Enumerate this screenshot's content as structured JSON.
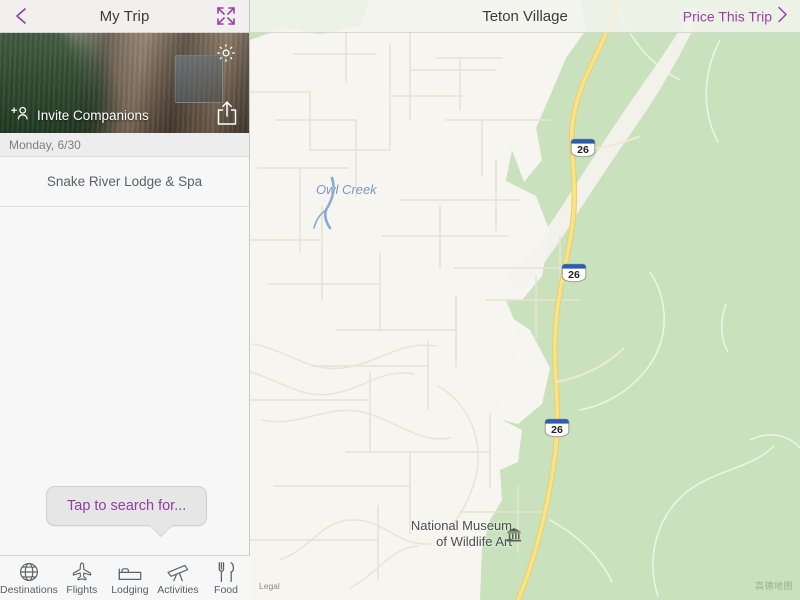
{
  "sidebar": {
    "header": {
      "title": "My Trip",
      "back_icon": "chevron-left-icon",
      "expand_icon": "expand-arrows-icon"
    },
    "hero": {
      "gear_icon": "gear-icon",
      "share_icon": "share-icon",
      "invite_icon": "add-person-icon",
      "invite_label": "Invite Companions"
    },
    "itinerary": {
      "day_label": "Monday, 6/30",
      "items": [
        {
          "title": "Snake River Lodge & Spa"
        }
      ]
    },
    "tooltip": {
      "text": "Tap to search for..."
    },
    "tabs": [
      {
        "label": "Destinations",
        "icon": "globe-icon"
      },
      {
        "label": "Flights",
        "icon": "airplane-icon"
      },
      {
        "label": "Lodging",
        "icon": "bed-icon"
      },
      {
        "label": "Activities",
        "icon": "telescope-icon"
      },
      {
        "label": "Food",
        "icon": "fork-knife-icon"
      }
    ]
  },
  "map": {
    "header": {
      "title": "Teton Village",
      "price_label": "Price This Trip",
      "price_chevron_icon": "chevron-right-icon"
    },
    "labels": {
      "creek": "Owl Creek",
      "museum_line1": "National Museum",
      "museum_line2": "of Wildlife Art",
      "museum_icon": "museum-icon"
    },
    "shields": [
      {
        "route": "26"
      },
      {
        "route": "26"
      },
      {
        "route": "26"
      }
    ],
    "legal": "Legal",
    "attribution": "高德地图"
  },
  "colors": {
    "accent_purple": "#9c3faa",
    "panel_bg": "#f7f7f7",
    "map_land": "#f7f5ef",
    "map_forest": "#c9e2bd",
    "highway_yellow": "#f0d978",
    "shield_blue": "#2a5fb0",
    "creek_blue": "#7b95c4"
  }
}
